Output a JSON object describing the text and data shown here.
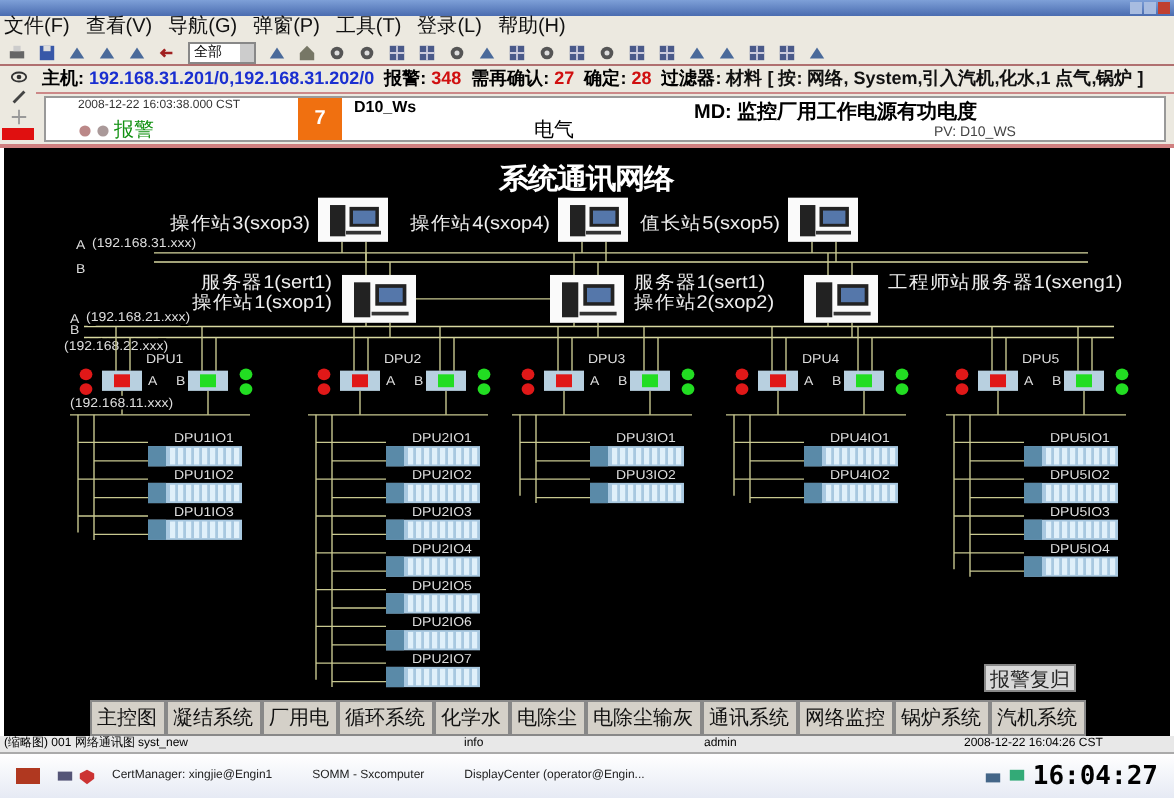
{
  "menu": [
    "文件(F)",
    "查看(V)",
    "导航(G)",
    "弹窗(P)",
    "工具(T)",
    "登录(L)",
    "帮助(H)"
  ],
  "toolbar": {
    "zoom_select": "全部"
  },
  "info_bar": [
    {
      "label": "主机:",
      "value": "192.168.31.201/0,192.168.31.202/0",
      "kind": "blue"
    },
    {
      "label": "报警:",
      "value": "348",
      "kind": "red"
    },
    {
      "label": "需再确认:",
      "value": "27",
      "kind": "red"
    },
    {
      "label": "确定:",
      "value": "28",
      "kind": "red"
    },
    {
      "label": "过滤器:",
      "value": "材料 [ 按: 网络, System,引入汽机,化水,1 点气,锅炉 ]",
      "kind": "plain"
    }
  ],
  "alarm": {
    "time": "2008-12-22 16:03:38.000 CST",
    "status": "报警",
    "priority": "7",
    "tag": "D10_Ws",
    "area": "电气",
    "description": "MD: 监控厂用工作电源有功电度",
    "value": "PV:  D10_WS"
  },
  "diagram": {
    "title": "系统通讯网络",
    "buses": [
      {
        "label": "A",
        "address": "(192.168.31.xxx)"
      },
      {
        "label": "B"
      },
      {
        "label": "A",
        "address": "(192.168.21.xxx)"
      },
      {
        "label": "B",
        "address": "(192.168.22.xxx)"
      }
    ],
    "upper_stations": [
      {
        "label": "操作站3(sxop3)"
      },
      {
        "label": "操作站4(sxop4)"
      },
      {
        "label": "值长站5(sxop5)"
      }
    ],
    "servers": [
      {
        "labels": [
          "服务器1(sert1)",
          "操作站1(sxop1)"
        ]
      },
      {
        "labels": [
          "服务器1(sert1)",
          "操作站2(sxop2)"
        ]
      },
      {
        "labels": [
          "工程师站服务器1(sxeng1)"
        ]
      }
    ],
    "controller_net": "(192.168.11.xxx)",
    "dpus": [
      {
        "name": "DPU1",
        "a_label": "A",
        "b_label": "B",
        "a_ok": false,
        "b_ok": true,
        "io": [
          "DPU1IO1",
          "DPU1IO2",
          "DPU1IO3"
        ]
      },
      {
        "name": "DPU2",
        "a_label": "A",
        "b_label": "B",
        "a_ok": false,
        "b_ok": true,
        "io": [
          "DPU2IO1",
          "DPU2IO2",
          "DPU2IO3",
          "DPU2IO4",
          "DPU2IO5",
          "DPU2IO6",
          "DPU2IO7"
        ]
      },
      {
        "name": "DPU3",
        "a_label": "A",
        "b_label": "B",
        "a_ok": false,
        "b_ok": true,
        "io": [
          "DPU3IO1",
          "DPU3IO2"
        ]
      },
      {
        "name": "DPU4",
        "a_label": "A",
        "b_label": "B",
        "a_ok": false,
        "b_ok": true,
        "io": [
          "DPU4IO1",
          "DPU4IO2"
        ]
      },
      {
        "name": "DPU5",
        "a_label": "A",
        "b_label": "B",
        "a_ok": false,
        "b_ok": true,
        "io": [
          "DPU5IO1",
          "DPU5IO2",
          "DPU5IO3",
          "DPU5IO4"
        ]
      }
    ],
    "reset_button": "报警复归"
  },
  "nav_buttons": [
    "主控图",
    "凝结系统",
    "厂用电",
    "循环系统",
    "化学水",
    "电除尘",
    "电除尘输灰",
    "通讯系统",
    "网络监控",
    "锅炉系统",
    "汽机系统"
  ],
  "status_bar": {
    "display": "(缩略图) 001  网络通讯图  syst_new",
    "info": "info",
    "user": "admin",
    "time": "2008-12-22 16:04:26 CST"
  },
  "taskbar": {
    "tasks": [
      "CertManager: xingjie@Engin1",
      "SOMM - Sxcomputer",
      "DisplayCenter (operator@Engin..."
    ],
    "clock": "16:04:27"
  }
}
